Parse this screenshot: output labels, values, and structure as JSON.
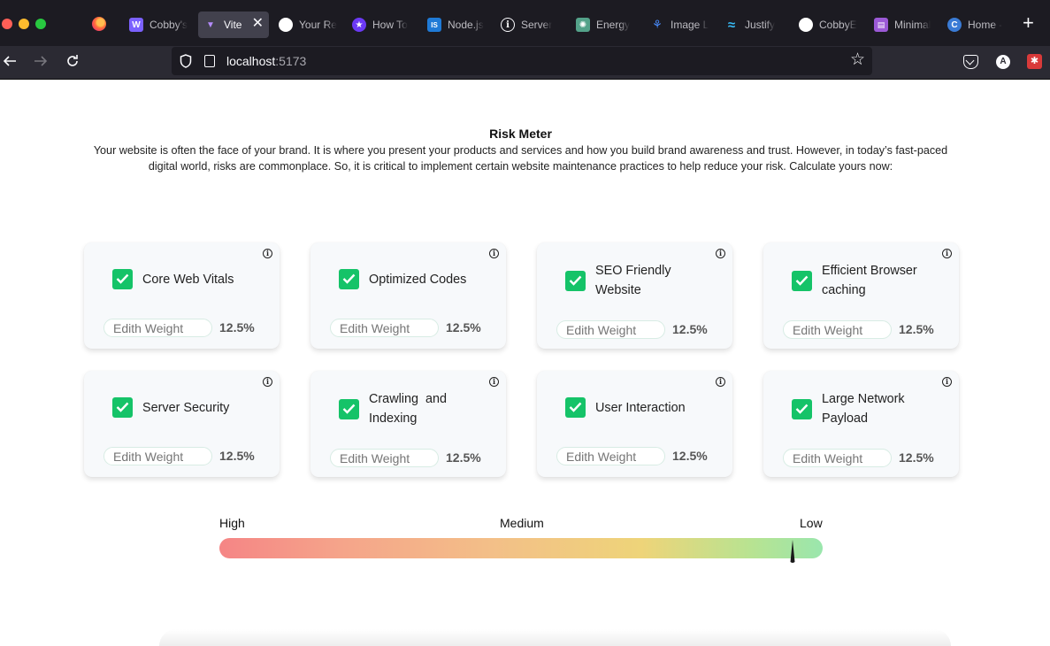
{
  "browser": {
    "tabs": [
      {
        "label": "Cobby's",
        "icon": "cobby-icon",
        "color": "#7b61ff",
        "glyph": "W"
      },
      {
        "label": "Vite",
        "icon": "vite-icon",
        "color": "#8a5cf6",
        "glyph": "▼",
        "active": true
      },
      {
        "label": "Your Re",
        "icon": "github-icon",
        "color": "#1c1b22",
        "glyph": "●"
      },
      {
        "label": "How To",
        "icon": "star-badge-icon",
        "color": "#6b39f5",
        "glyph": "★"
      },
      {
        "label": "Node.js",
        "icon": "nodejs-icon",
        "color": "#1f7ad6",
        "glyph": "IS"
      },
      {
        "label": "Server",
        "icon": "info-circle-icon",
        "color": "#1c1b22",
        "glyph": "i"
      },
      {
        "label": "Energy",
        "icon": "openai-icon",
        "color": "#54a28a",
        "glyph": "✺"
      },
      {
        "label": "Image L",
        "icon": "image-logo-icon",
        "color": "#1c1b22",
        "glyph": "⚘"
      },
      {
        "label": "Justify",
        "icon": "tailwind-icon",
        "color": "#1c1b22",
        "glyph": "≈"
      },
      {
        "label": "CobbyE",
        "icon": "github-icon",
        "color": "#1c1b22",
        "glyph": "●"
      },
      {
        "label": "Minimal",
        "icon": "minimal-icon",
        "color": "#9b59d6",
        "glyph": "▤"
      },
      {
        "label": "Home -",
        "icon": "canva-icon",
        "color": "#3a7bd5",
        "glyph": "C"
      }
    ],
    "close_glyph": "✕",
    "new_tab_glyph": "+",
    "url_host": "localhost",
    "url_port": ":5173",
    "account_initial": "A"
  },
  "page": {
    "title": "Risk Meter",
    "description": "Your website is often the face of your brand. It is where you present your products and services and how you build brand awareness and trust. However, in today’s fast-paced digital world, risks are commonplace. So, it is critical to implement certain website maintenance practices to help reduce your risk. Calculate yours now:",
    "info_glyph": "i"
  },
  "cards": [
    {
      "label": "Core Web Vitals",
      "placeholder": "Edith Weight",
      "percent": "12.5%",
      "checked": true
    },
    {
      "label": "Optimized Codes",
      "placeholder": "Edith Weight",
      "percent": "12.5%",
      "checked": true
    },
    {
      "label": "SEO Friendly Website",
      "placeholder": "Edith Weight",
      "percent": "12.5%",
      "checked": true
    },
    {
      "label": "Efficient Browser caching",
      "placeholder": "Edith Weight",
      "percent": "12.5%",
      "checked": true
    },
    {
      "label": "Server Security",
      "placeholder": "Edith Weight",
      "percent": "12.5%",
      "checked": true
    },
    {
      "label": "Crawling  and Indexing",
      "placeholder": "Edith Weight",
      "percent": "12.5%",
      "checked": true
    },
    {
      "label": "User Interaction",
      "placeholder": "Edith Weight",
      "percent": "12.5%",
      "checked": true
    },
    {
      "label": "Large Network Payload",
      "placeholder": "Edith Weight",
      "percent": "12.5%",
      "checked": true
    }
  ],
  "meter": {
    "high_label": "High",
    "medium_label": "Medium",
    "low_label": "Low",
    "risk_level": 0.95,
    "colors": {
      "high": "#f58585",
      "medium": "#eed479",
      "low": "#9ae6ad"
    }
  }
}
